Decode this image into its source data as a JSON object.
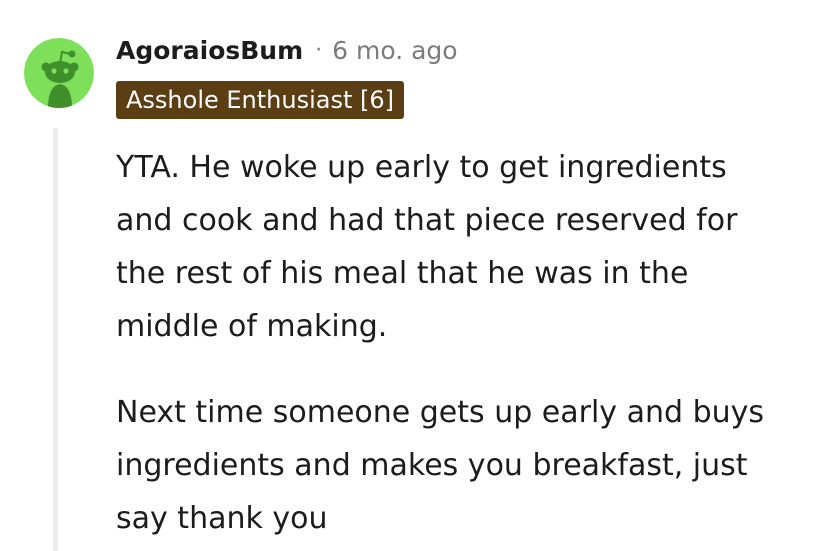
{
  "comment": {
    "author": "AgoraiosBum",
    "separator": "·",
    "timestamp": "6 mo. ago",
    "flair": "Asshole Enthusiast [6]",
    "avatar": {
      "icon": "snoo-avatar-icon",
      "background_color": "#7ee05a"
    },
    "paragraphs": [
      "YTA. He woke up early to get ingredients\nand cook and had that piece reserved for\nthe rest of his meal that he was in the\nmiddle of making.",
      "Next time someone gets up early and buys\ningredients and makes you breakfast, just\nsay thank you"
    ]
  },
  "colors": {
    "flair_background": "#5b3e14",
    "flair_text": "#ffffff",
    "meta_text": "#7c7c7c",
    "body_text": "#1c1c1c",
    "thread_line": "#ececec"
  }
}
